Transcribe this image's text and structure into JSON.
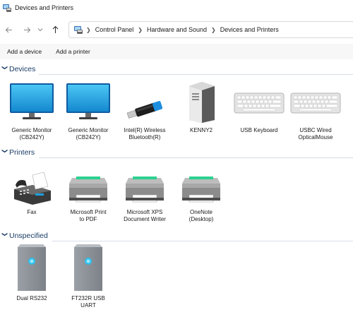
{
  "window": {
    "title": "Devices and Printers"
  },
  "breadcrumb": [
    "Control Panel",
    "Hardware and Sound",
    "Devices and Printers"
  ],
  "commands": {
    "add_device": "Add a device",
    "add_printer": "Add a printer"
  },
  "groups": {
    "devices": {
      "name": "Devices",
      "items": [
        {
          "line1": "Generic Monitor",
          "line2": "(CB242Y)",
          "icon": "monitor-icon"
        },
        {
          "line1": "Generic Monitor",
          "line2": "(CB242Y)",
          "icon": "monitor-icon"
        },
        {
          "line1": "Intel(R) Wireless",
          "line2": "Bluetooth(R)",
          "icon": "bluetooth-dongle-icon"
        },
        {
          "line1": "KENNY2",
          "line2": "",
          "icon": "computer-tower-icon"
        },
        {
          "line1": "USB Keyboard",
          "line2": "",
          "icon": "keyboard-icon"
        },
        {
          "line1": "USBC Wired",
          "line2": "OpticalMouse",
          "icon": "keyboard-icon"
        }
      ]
    },
    "printers": {
      "name": "Printers",
      "items": [
        {
          "line1": "Fax",
          "line2": "",
          "icon": "fax-icon"
        },
        {
          "line1": "Microsoft Print",
          "line2": "to PDF",
          "icon": "printer-icon"
        },
        {
          "line1": "Microsoft XPS",
          "line2": "Document Writer",
          "icon": "printer-icon"
        },
        {
          "line1": "OneNote",
          "line2": "(Desktop)",
          "icon": "printer-icon"
        }
      ]
    },
    "unspecified": {
      "name": "Unspecified",
      "items": [
        {
          "line1": "Dual RS232",
          "line2": "",
          "icon": "generic-device-icon"
        },
        {
          "line1": "FT232R USB",
          "line2": "UART",
          "icon": "generic-device-icon"
        }
      ]
    }
  }
}
